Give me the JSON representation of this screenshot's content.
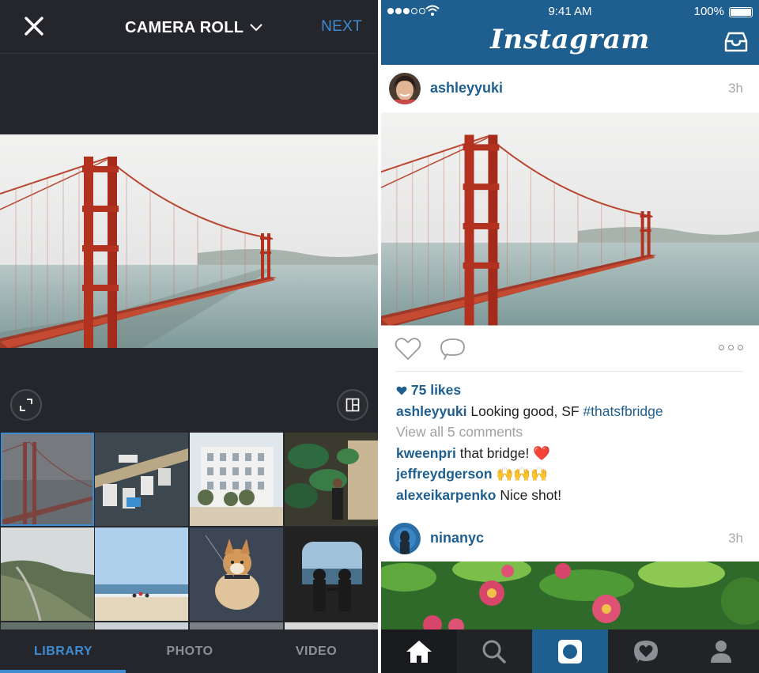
{
  "camera": {
    "title": "CAMERA ROLL",
    "next_label": "NEXT",
    "tabs": [
      "LIBRARY",
      "PHOTO",
      "VIDEO"
    ],
    "active_tab": "LIBRARY",
    "icons": {
      "close": "close-icon",
      "dropdown": "chevron-down-icon",
      "expand": "expand-icon",
      "layout": "layout-icon"
    }
  },
  "status": {
    "time": "9:41 AM",
    "battery": "100%"
  },
  "feed": {
    "logo": "Instagram",
    "posts": [
      {
        "username": "ashleyyuki",
        "time": "3h",
        "likes": "75 likes",
        "caption_user": "ashleyyuki",
        "caption_text": "Looking good, SF ",
        "caption_tag": "#thatsfbridge",
        "view_all": "View all 5 comments",
        "comments": [
          {
            "user": "kweenpri",
            "text": "that bridge! ❤️"
          },
          {
            "user": "jeffreydgerson",
            "text": "🙌🙌🙌"
          },
          {
            "user": "alexeikarpenko",
            "text": "Nice shot!"
          }
        ]
      },
      {
        "username": "ninanyc",
        "time": "3h"
      }
    ]
  },
  "nav": {
    "items": [
      "home-icon",
      "search-icon",
      "camera-icon",
      "activity-icon",
      "profile-icon"
    ],
    "active": "camera-icon"
  },
  "colors": {
    "brand_blue": "#1f5f8f",
    "accent_blue": "#3f8bd1",
    "dark_bg": "#25262b"
  }
}
